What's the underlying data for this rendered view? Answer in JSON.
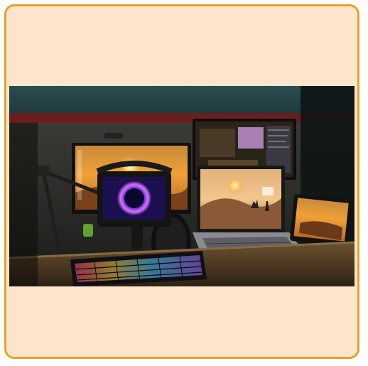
{
  "image": {
    "scene": "computer-desk-setup",
    "colors": {
      "frame_border": "#e0a52a",
      "frame_fill": "#fde4cc",
      "wall": "#2a4d50",
      "shelf_stripe": "#6b1e1e",
      "screen_glow": "#f5a030",
      "keyboard_rgb": "#55d1ff"
    }
  }
}
